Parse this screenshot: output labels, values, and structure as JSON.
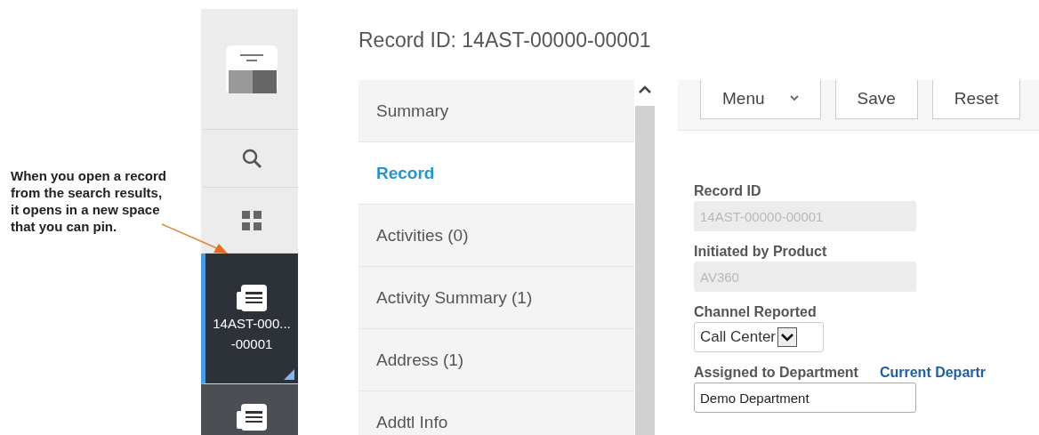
{
  "callout": {
    "text": "When you open a record from the search results, it opens in a new space that you can pin."
  },
  "sidebar": {
    "items": [
      {
        "kind": "logo",
        "selected": false
      },
      {
        "kind": "search",
        "selected": false
      },
      {
        "kind": "apps",
        "selected": false
      },
      {
        "kind": "record",
        "selected": true,
        "lines": [
          "14AST-000...",
          "-00001"
        ]
      },
      {
        "kind": "record",
        "selected": false
      }
    ]
  },
  "title": "Record ID: 14AST-00000-00001",
  "nav": {
    "items": [
      {
        "label": "Summary",
        "selected": false
      },
      {
        "label": "Record",
        "selected": true
      },
      {
        "label": "Activities (0)",
        "selected": false
      },
      {
        "label": "Activity Summary (1)",
        "selected": false
      },
      {
        "label": "Address (1)",
        "selected": false
      },
      {
        "label": "Addtl Info",
        "selected": false
      }
    ]
  },
  "toolbar": {
    "buttons": [
      {
        "kind": "dropdown",
        "label": "Menu"
      },
      {
        "kind": "button",
        "label": "Save"
      },
      {
        "kind": "button",
        "label": "Reset"
      }
    ]
  },
  "form": {
    "fields": [
      {
        "kind": "text",
        "label": "Record ID",
        "value": "14AST-00000-00001",
        "disabled": true
      },
      {
        "kind": "text",
        "label": "Initiated by Product",
        "value": "AV360",
        "disabled": true
      },
      {
        "kind": "select",
        "label": "Channel Reported",
        "value": "Call Center",
        "disabled": false
      },
      {
        "kind": "text",
        "label": "Assigned to Department",
        "link": "Current Departr",
        "value": "Demo Department",
        "disabled": false
      }
    ]
  }
}
